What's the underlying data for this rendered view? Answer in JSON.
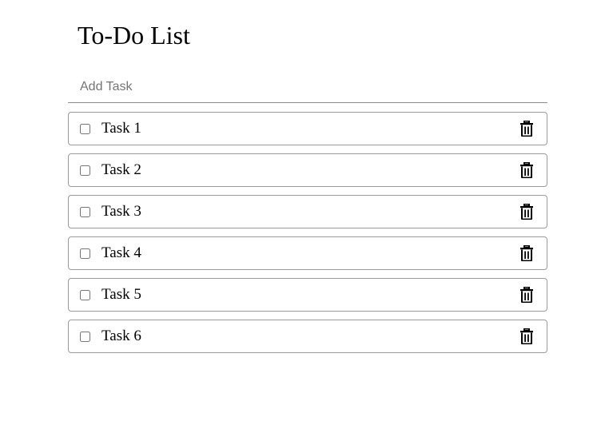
{
  "header": {
    "title": "To-Do List"
  },
  "new_task": {
    "placeholder": "Add Task",
    "value": ""
  },
  "tasks": [
    {
      "label": "Task 1",
      "completed": false
    },
    {
      "label": "Task 2",
      "completed": false
    },
    {
      "label": "Task 3",
      "completed": false
    },
    {
      "label": "Task 4",
      "completed": false
    },
    {
      "label": "Task 5",
      "completed": false
    },
    {
      "label": "Task 6",
      "completed": false
    }
  ],
  "icons": {
    "delete": "trash-icon"
  },
  "colors": {
    "text": "#000000",
    "border": "#9a9a9a",
    "placeholder": "#757575"
  }
}
